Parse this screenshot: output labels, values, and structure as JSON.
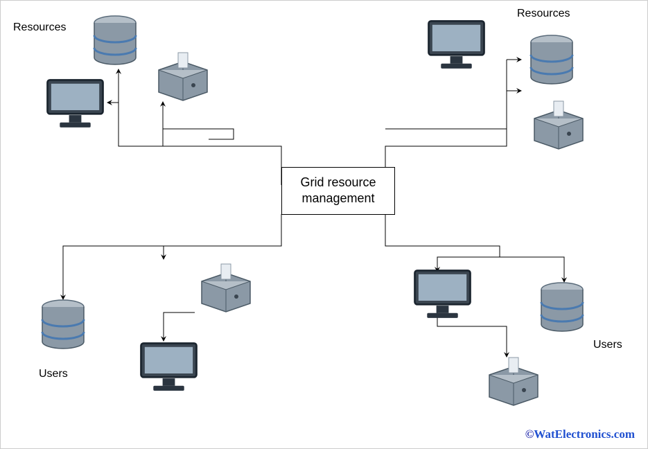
{
  "labels": {
    "resources_tl": "Resources",
    "resources_tr": "Resources",
    "users_bl": "Users",
    "users_br": "Users"
  },
  "center": {
    "line1": "Grid resource",
    "line2": "management"
  },
  "watermark": {
    "copy": "©",
    "site": "WatElectronics.com"
  },
  "icons": {
    "monitor": "monitor-icon",
    "database": "database-icon",
    "printer": "printer-icon"
  },
  "diagram": {
    "description": "Grid computing architecture showing a central Grid resource management node connected to four quadrants. Top-left and top-right quadrants are labeled 'Resources' and contain a monitor, a database cylinder, and a printer each. Bottom-left and bottom-right quadrants are labeled 'Users' and also contain a monitor, a database cylinder, and a printer each. Arrows indicate bidirectional flow between the central management node and each cluster."
  }
}
